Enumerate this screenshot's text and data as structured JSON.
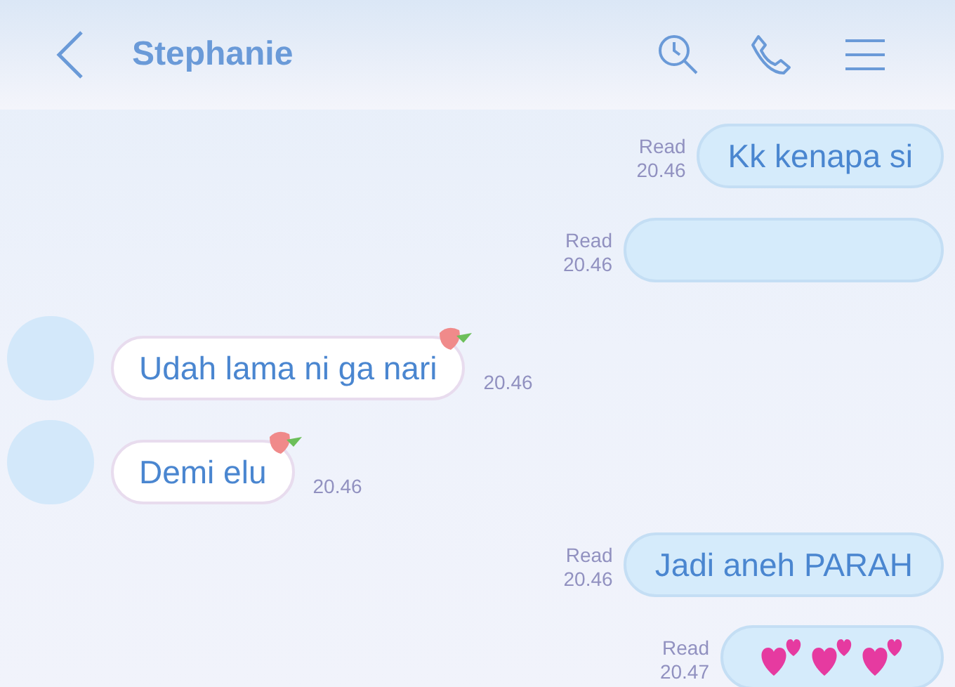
{
  "header": {
    "title": "Stephanie"
  },
  "messages": [
    {
      "kind": "sent",
      "text": "Kk kenapa si",
      "read": "Read",
      "time": "20.46"
    },
    {
      "kind": "sent_blank",
      "read": "Read",
      "time": "20.46"
    },
    {
      "kind": "received",
      "text": "Udah lama ni ga nari",
      "time": "20.46"
    },
    {
      "kind": "received",
      "text": "Demi elu",
      "time": "20.46"
    },
    {
      "kind": "sent",
      "text": "Jadi aneh PARAH",
      "read": "Read",
      "time": "20.46"
    },
    {
      "kind": "sent_hearts",
      "read": "Read",
      "time": "20.47"
    }
  ]
}
